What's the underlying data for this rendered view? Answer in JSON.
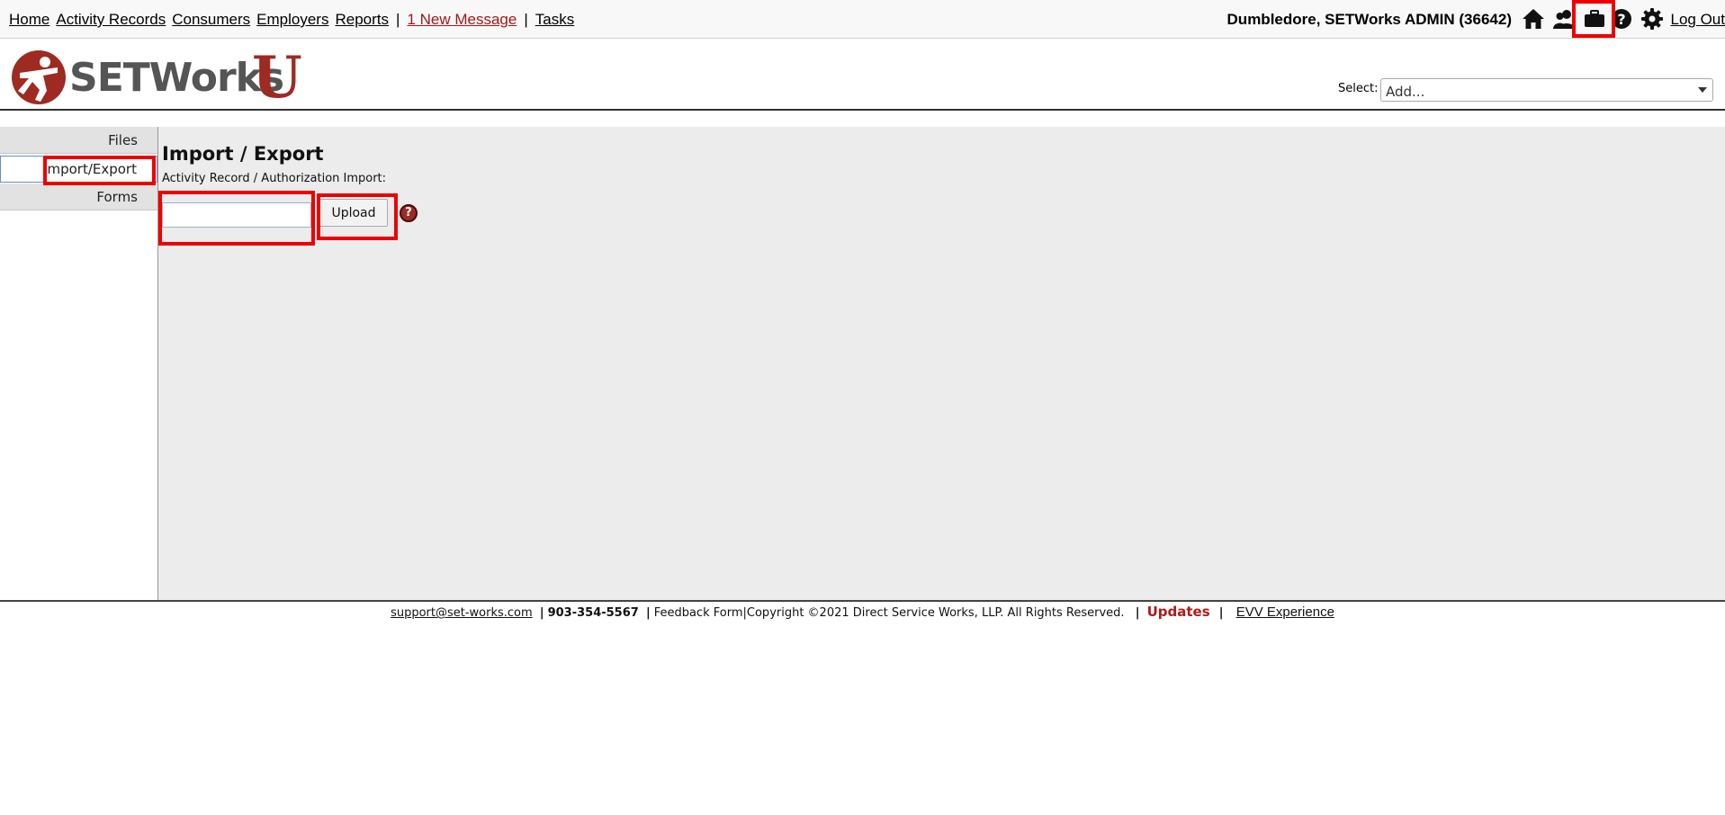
{
  "nav": {
    "home": "Home",
    "activity_records": "Activity Records",
    "consumers": "Consumers",
    "employers": "Employers",
    "reports": "Reports",
    "separator": "|",
    "new_message": "1 New Message",
    "tasks": "Tasks"
  },
  "user": {
    "name": "Dumbledore, SETWorks ADMIN  (36642)",
    "logout": "Log Out"
  },
  "toolbar_icons": [
    "home-icon",
    "users-icon",
    "briefcase-icon",
    "help-icon",
    "gear-icon"
  ],
  "logo": {
    "text": "SETWorks",
    "letter": "U"
  },
  "select": {
    "label": "Select:",
    "value": "Add..."
  },
  "sidebar": {
    "items": [
      {
        "label": "Files"
      },
      {
        "label": "Import/Export"
      },
      {
        "label": "Forms"
      }
    ]
  },
  "main": {
    "title": "Import / Export",
    "import_label": "Activity Record / Authorization Import:",
    "upload_label": "Upload",
    "help_glyph": "?"
  },
  "footer": {
    "email": "support@set-works.com",
    "phone": "903-354-5567",
    "feedback": "Feedback Form",
    "copyright": "Copyright ©2021 Direct Service Works, LLP. All Rights Reserved.",
    "updates": "Updates",
    "evv": "EVV Experience"
  },
  "colors": {
    "brand": "#9e2a22",
    "highlight": "#ee0000",
    "message": "#a31818"
  }
}
